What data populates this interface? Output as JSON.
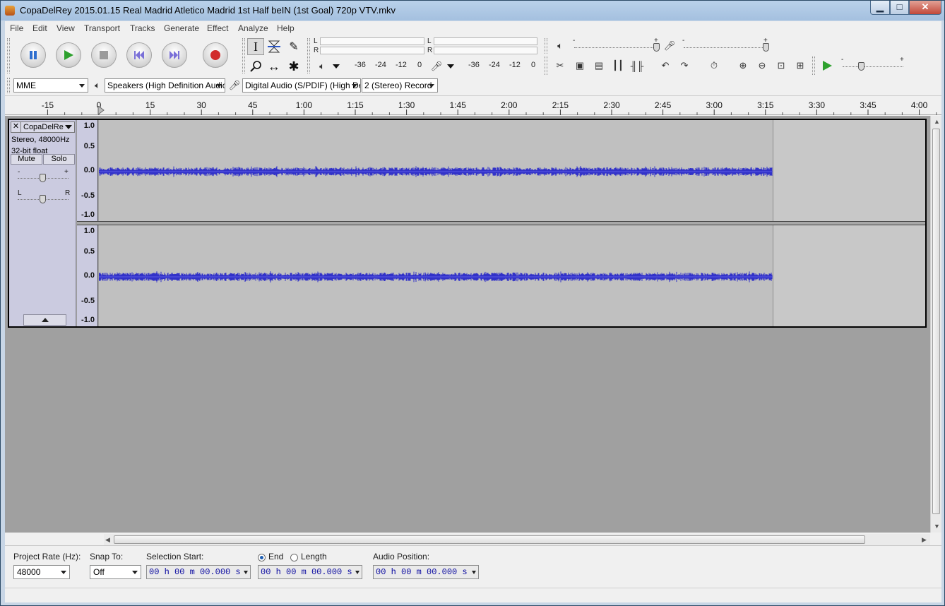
{
  "window": {
    "title": "CopaDelRey 2015.01.15 Real Madrid Atletico Madrid 1st Half beIN (1st Goal) 720p VTV.mkv",
    "minimize_glyph": "▁",
    "maximize_glyph": "□",
    "close_glyph": "✕"
  },
  "menu": [
    "File",
    "Edit",
    "View",
    "Transport",
    "Tracks",
    "Generate",
    "Effect",
    "Analyze",
    "Help"
  ],
  "transport": {
    "buttons": [
      "pause",
      "play",
      "stop",
      "skip-to-start",
      "skip-to-end",
      "record"
    ],
    "colors": {
      "pause": "#2f6fcf",
      "play": "#2ea12e",
      "stop": "#9b9b9b",
      "skip": "#7a70d8",
      "record": "#d12b2b"
    }
  },
  "tools": {
    "selection": "I",
    "envelope": "envelope",
    "draw": "✎",
    "zoom": "zoom",
    "timeshift": "↔",
    "multi": "✱"
  },
  "meters": {
    "playback": {
      "left": "L",
      "right": "R",
      "ticks": [
        "-36",
        "-24",
        "-12",
        "0"
      ]
    },
    "record": {
      "left": "L",
      "right": "R",
      "ticks": [
        "-36",
        "-24",
        "-12",
        "0"
      ]
    }
  },
  "mixer": {
    "minus": "-",
    "plus": "+"
  },
  "device": {
    "host": "MME",
    "output": "Speakers (High Definition Audio",
    "input": "Digital Audio (S/PDIF) (High De",
    "channels": "2 (Stereo) Record"
  },
  "ruler": {
    "ticks": [
      "-15",
      "0",
      "15",
      "30",
      "45",
      "1:00",
      "1:15",
      "1:30",
      "1:45",
      "2:00",
      "2:15",
      "2:30",
      "2:45",
      "3:00",
      "3:15",
      "3:30",
      "3:45",
      "4:00"
    ]
  },
  "track": {
    "name": "CopaDelRe",
    "format": "Stereo, 48000Hz",
    "bit_depth": "32-bit float",
    "mute": "Mute",
    "solo": "Solo",
    "gain_minus": "-",
    "gain_plus": "+",
    "pan_left": "L",
    "pan_right": "R",
    "close": "✕",
    "vruler": [
      "1.0",
      "0.5",
      "0.0",
      "-0.5",
      "-1.0"
    ],
    "wave_color": "#3232c8",
    "audio_length": "3:17"
  },
  "selection_bar": {
    "project_rate_label": "Project Rate (Hz):",
    "project_rate": "48000",
    "snap_label": "Snap To:",
    "snap_value": "Off",
    "selection_start_label": "Selection Start:",
    "selection_start": "00 h 00 m 00.000 s",
    "end_label": "End",
    "length_label": "Length",
    "end_value": "00 h 00 m 00.000 s",
    "audio_position_label": "Audio Position:",
    "audio_position": "00 h 00 m 00.000 s"
  }
}
